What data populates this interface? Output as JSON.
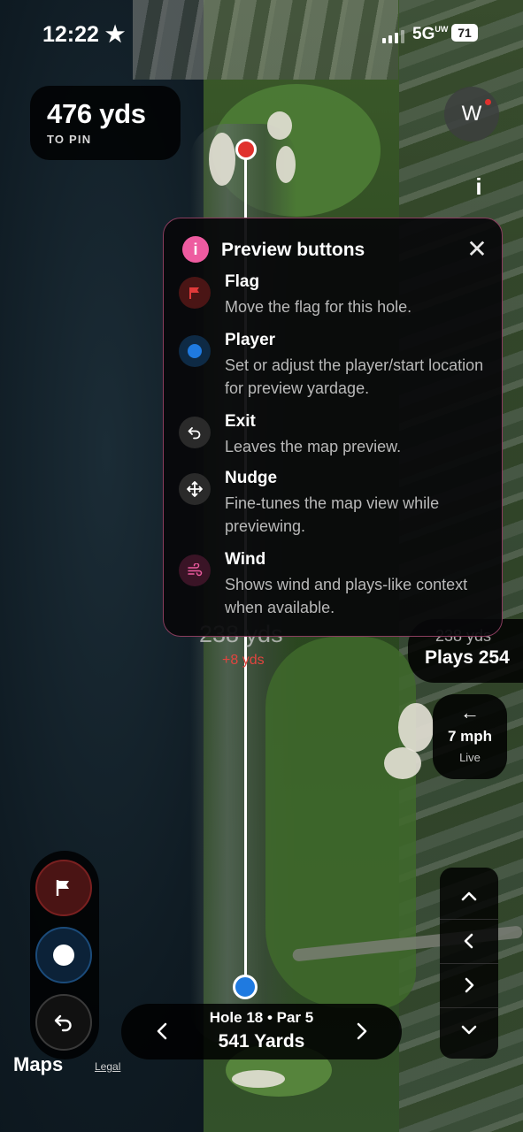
{
  "status_bar": {
    "time": "12:22",
    "time_star": "★",
    "network": "5G",
    "network_suffix": "UW",
    "battery": "71"
  },
  "distance_card": {
    "value": "476 yds",
    "label": "TO PIN"
  },
  "compass": {
    "heading": "W"
  },
  "info_button": {
    "glyph": "i"
  },
  "preview_modal": {
    "icon_glyph": "i",
    "title": "Preview buttons",
    "close_glyph": "✕",
    "items": [
      {
        "name": "Flag",
        "description": "Move the flag for this hole.",
        "icon": "flag-icon",
        "icon_bg": "#4a1515"
      },
      {
        "name": "Player",
        "description": "Set or adjust the player/start location for preview yardage.",
        "icon": "player-dot-icon",
        "icon_bg": "#0e2a45"
      },
      {
        "name": "Exit",
        "description": "Leaves the map preview.",
        "icon": "exit-arrow-icon",
        "icon_bg": "#2a2a2a"
      },
      {
        "name": "Nudge",
        "description": "Fine-tunes the map view while previewing.",
        "icon": "move-icon",
        "icon_bg": "#2a2a2a"
      },
      {
        "name": "Wind",
        "description": "Shows wind and plays-like context when available.",
        "icon": "wind-icon",
        "icon_bg": "#3a1426"
      }
    ]
  },
  "map_labels": {
    "mid_distance": "238 yds",
    "mid_delta": "+8 yds"
  },
  "plays_card": {
    "distance": "238 yds",
    "plays": "Plays 254"
  },
  "wind_card": {
    "arrow": "←",
    "speed": "7 mph",
    "status": "Live"
  },
  "hole_nav": {
    "line1": "Hole 18 • Par 5",
    "line2": "541 Yards",
    "prev_icon": "chevron-left-icon",
    "next_icon": "chevron-right-icon"
  },
  "attribution": {
    "maps": "Maps",
    "legal": "Legal"
  },
  "colors": {
    "pin": "#e0312d",
    "player": "#1f7ae0",
    "accent": "#ee5ba0",
    "delta": "#e1453f"
  }
}
